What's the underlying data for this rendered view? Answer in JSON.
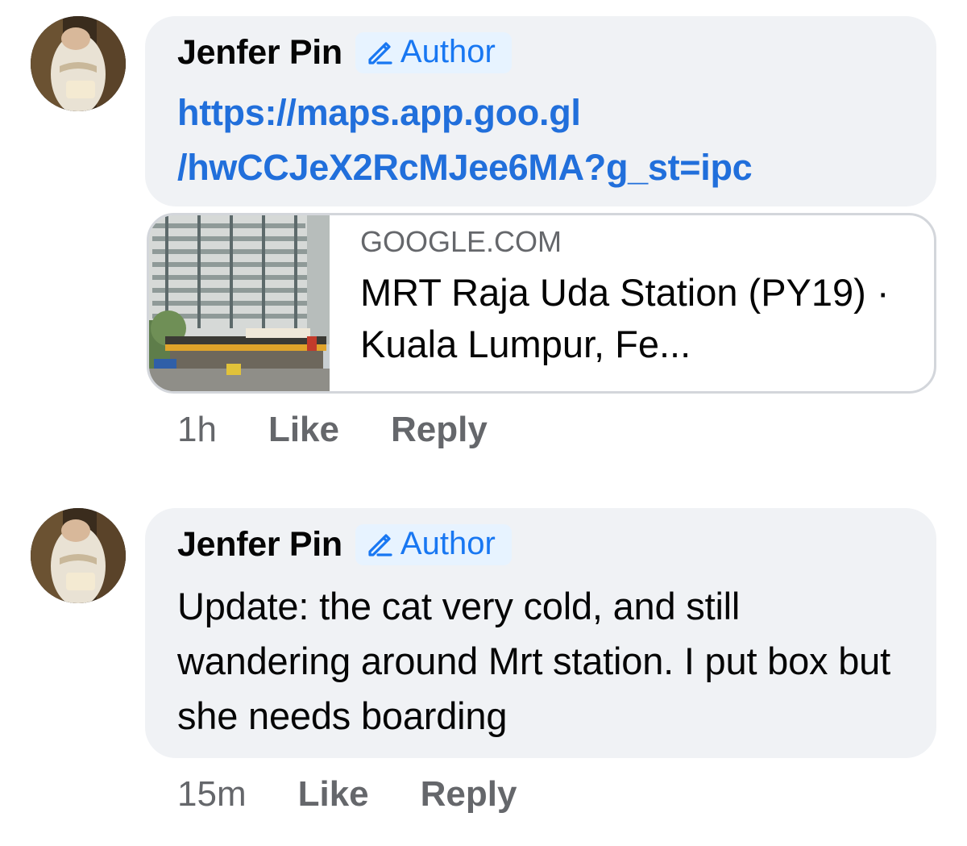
{
  "comments": [
    {
      "author": "Jenfer Pin",
      "badge": "Author",
      "link_line1": "https://maps.app.goo.gl",
      "link_line2": "/hwCCJeX2RcMJee6MA?g_st=ipc",
      "preview": {
        "domain": "GOOGLE.COM",
        "title": "MRT Raja Uda Station (PY19) · Kuala Lumpur, Fe..."
      },
      "time": "1h",
      "like": "Like",
      "reply": "Reply"
    },
    {
      "author": "Jenfer Pin",
      "badge": "Author",
      "text": "Update: the cat very cold, and still wandering around Mrt station. I put box but she needs boarding",
      "time": "15m",
      "like": "Like",
      "reply": "Reply"
    }
  ],
  "icons": {
    "badge": "pencil-icon"
  },
  "colors": {
    "link": "#216fdb",
    "badge_text": "#1877f2",
    "badge_bg": "#e7f3ff",
    "bubble_bg": "#f0f2f5",
    "secondary_text": "#65676b"
  }
}
